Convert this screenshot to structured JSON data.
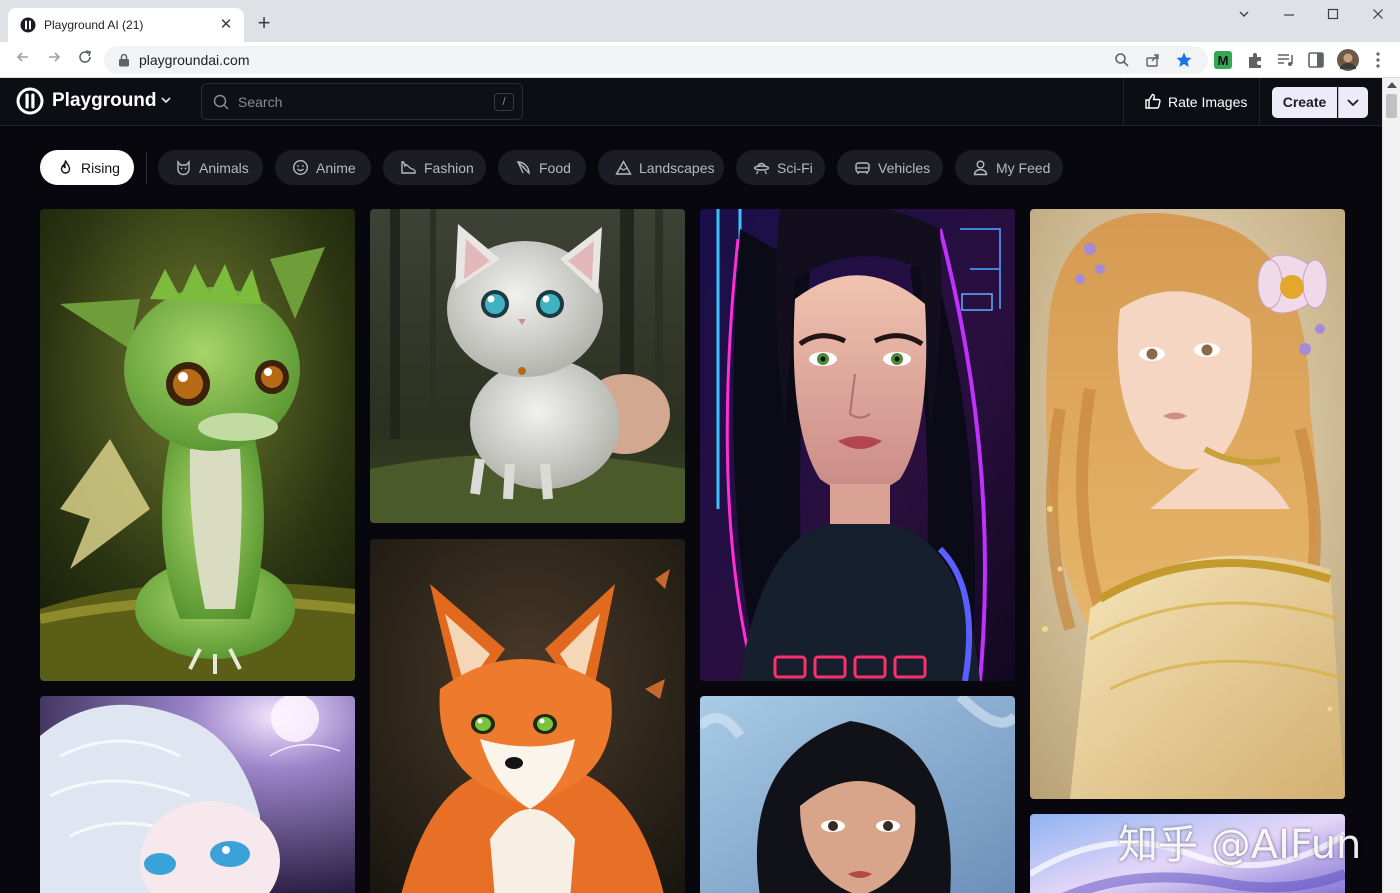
{
  "browser": {
    "tab_title": "Playground AI (21)",
    "url": "playgroundai.com",
    "new_tab_label": "+",
    "close_tab_label": "✕"
  },
  "app": {
    "brand": "Playground",
    "search": {
      "placeholder": "Search",
      "shortcut": "/"
    },
    "rate_label": "Rate Images",
    "create_label": "Create"
  },
  "categories": [
    {
      "label": "Rising",
      "icon": "flame-icon",
      "active": true
    },
    {
      "label": "Animals",
      "icon": "cat-icon",
      "active": false
    },
    {
      "label": "Anime",
      "icon": "smile-icon",
      "active": false
    },
    {
      "label": "Fashion",
      "icon": "shoe-icon",
      "active": false
    },
    {
      "label": "Food",
      "icon": "pizza-icon",
      "active": false
    },
    {
      "label": "Landscapes",
      "icon": "mountain-icon",
      "active": false
    },
    {
      "label": "Sci-Fi",
      "icon": "ufo-icon",
      "active": false
    },
    {
      "label": "Vehicles",
      "icon": "car-icon",
      "active": false
    },
    {
      "label": "My Feed",
      "icon": "user-icon",
      "active": false
    }
  ],
  "watermark": "知乎 @AIFun",
  "colors": {
    "accent": "#ecebf7",
    "background": "#07070d",
    "pill": "#1c1c24"
  }
}
